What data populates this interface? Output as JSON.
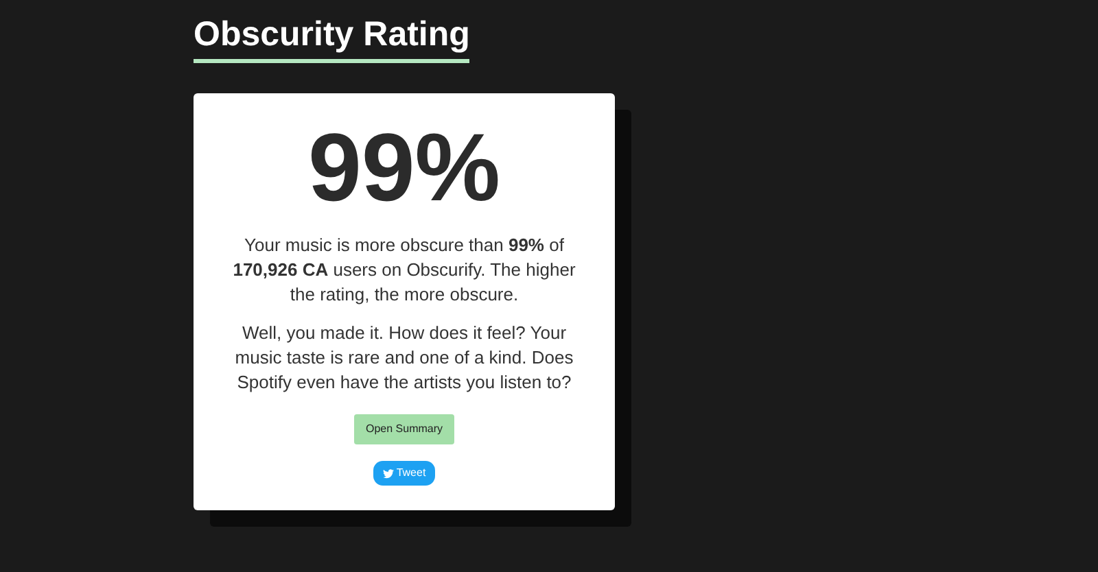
{
  "title": "Obscurity Rating",
  "card": {
    "percentage": "99%",
    "summary": "Your music is more obscure than **99%** of **170,926 CA** users on Obscurify. The higher the rating, the more obscure.",
    "comment": "Well, you made it. How does it feel? Your music taste is rare and one of a kind. Does Spotify even have the artists you listen to?",
    "summary_button": "Open Summary",
    "tweet_button": "Tweet"
  }
}
